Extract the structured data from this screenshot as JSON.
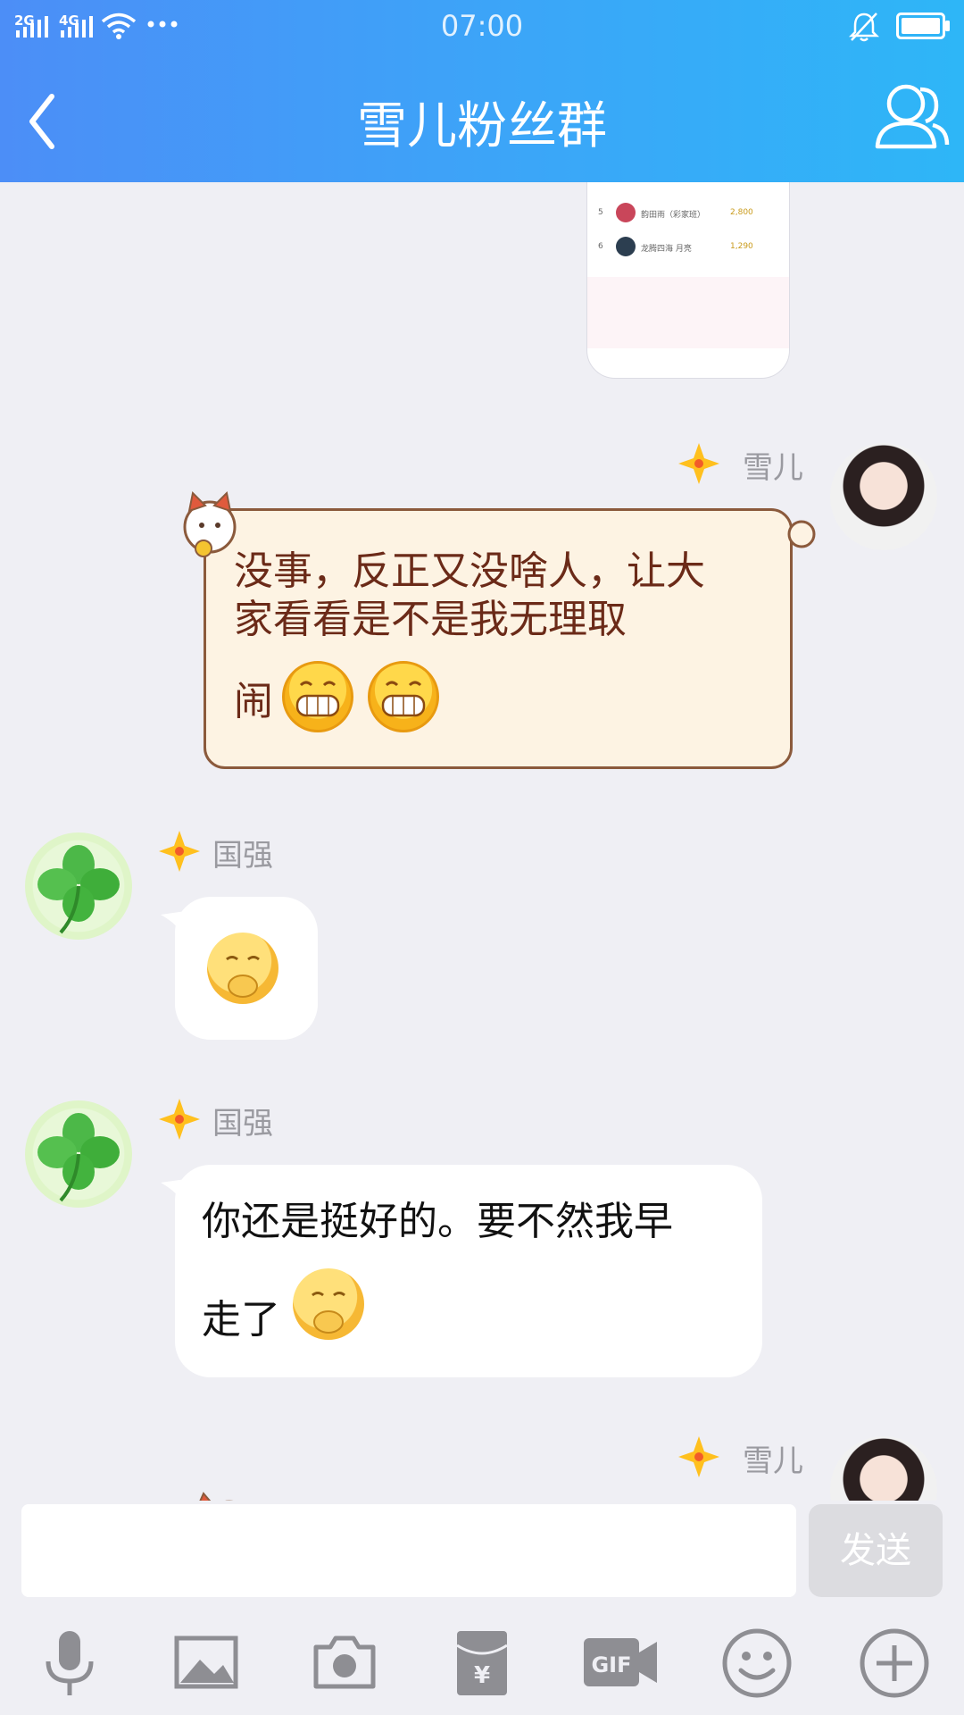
{
  "status_bar": {
    "signal_2g": "2G",
    "signal_4g": "4G",
    "time": "07:00"
  },
  "header": {
    "title": "雪儿粉丝群"
  },
  "shared_screenshot": {
    "rows": [
      {
        "rank": "5",
        "name": "韵田雨（彩家班）",
        "value": "2,800"
      },
      {
        "rank": "6",
        "name": "龙腾四海 月亮",
        "value": "1,290"
      }
    ]
  },
  "messages": [
    {
      "sender": "雪儿",
      "side": "right",
      "lines": [
        "没事，反正又没啥人，让大",
        "家看看是不是我无理取",
        "闹"
      ],
      "emojis": [
        "grin-emoji",
        "grin-emoji"
      ]
    },
    {
      "sender": "国强",
      "side": "left",
      "lines": [],
      "emojis": [
        "shy-emoji"
      ]
    },
    {
      "sender": "国强",
      "side": "left",
      "lines": [
        "你还是挺好的。要不然我早",
        "走了"
      ],
      "emojis": [
        "shy-emoji"
      ]
    },
    {
      "sender": "雪儿",
      "side": "right",
      "lines": [],
      "emojis": []
    }
  ],
  "input_bar": {
    "send_label": "发送"
  },
  "toolbar": {
    "icons": [
      "mic-icon",
      "image-icon",
      "camera-icon",
      "red-packet-icon",
      "gif-icon",
      "emoji-icon",
      "plus-icon"
    ]
  },
  "colors": {
    "header_start": "#4C8EF7",
    "header_end": "#2EB6F7",
    "background": "#EFEFF4",
    "scroll_text": "#6B2A18"
  }
}
